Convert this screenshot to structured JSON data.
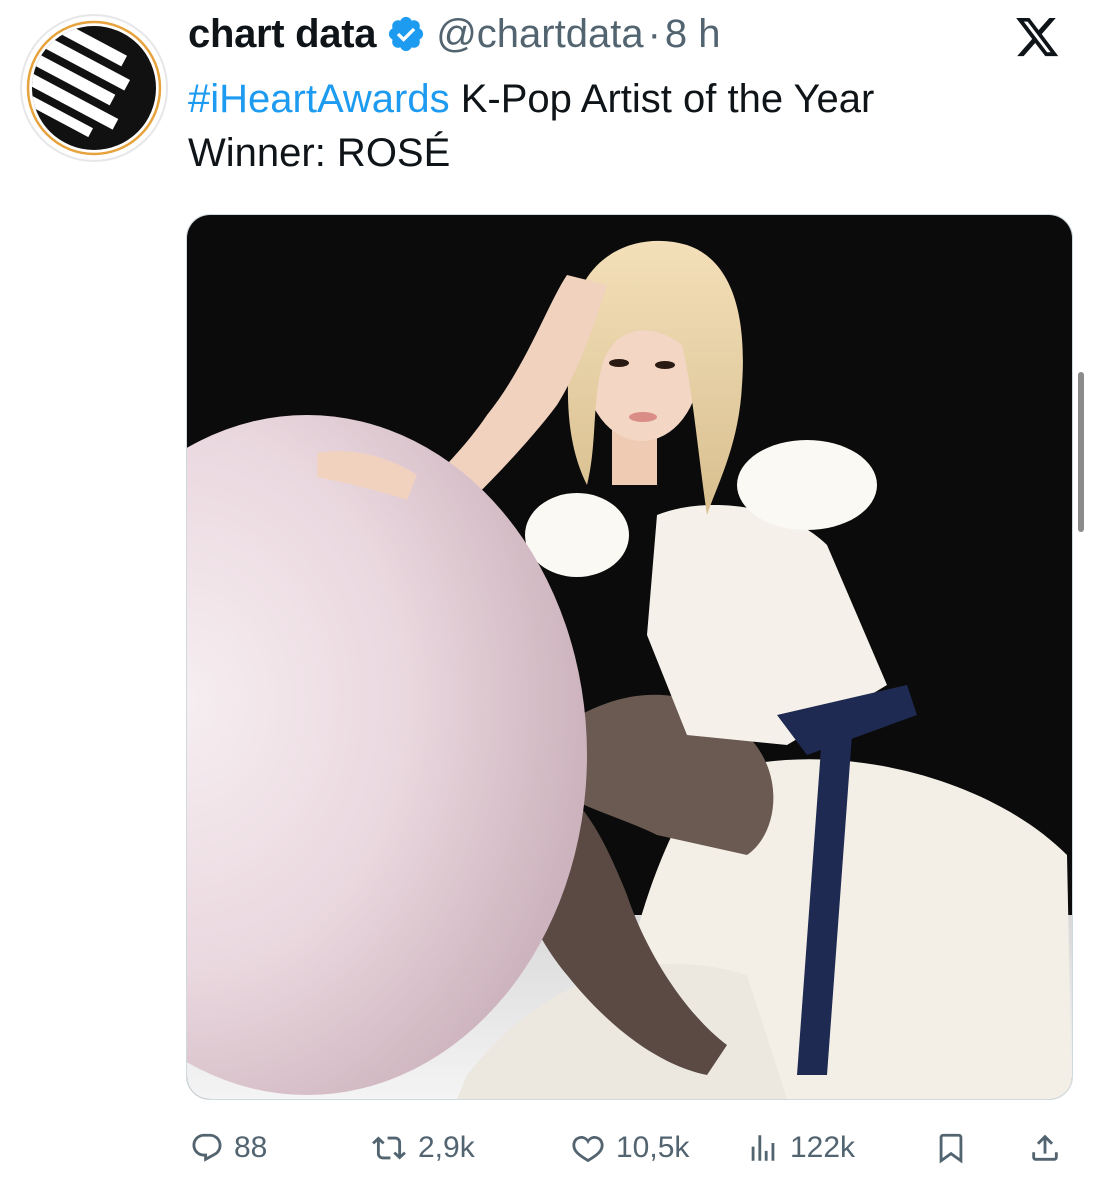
{
  "author": {
    "display_name": "chart data",
    "handle": "@chartdata",
    "separator": "·",
    "time": "8 h",
    "verified": true
  },
  "tweet": {
    "hashtag": "#iHeartAwards",
    "text_line1": " K-Pop Artist of the Year",
    "text_line2": "Winner: ROSÉ"
  },
  "actions": {
    "replies": "88",
    "reposts": "2,9k",
    "likes": "10,5k",
    "views": "122k"
  },
  "icons": {
    "brand": "x-logo-icon",
    "verified": "verified-badge-icon",
    "reply": "reply-icon",
    "repost": "repost-icon",
    "like": "like-icon",
    "views": "views-icon",
    "bookmark": "bookmark-icon",
    "share": "share-icon"
  },
  "colors": {
    "accent": "#1d9bf0",
    "secondary_text": "#536471",
    "primary_text": "#0f1419"
  }
}
